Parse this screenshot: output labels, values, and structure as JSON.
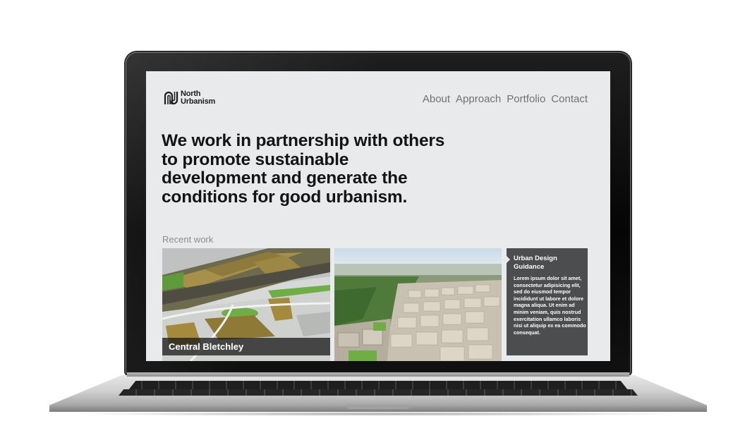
{
  "brand": {
    "line1": "North",
    "line2": "Urbanism"
  },
  "nav": {
    "about": "About",
    "approach": "Approach",
    "portfolio": "Portfolio",
    "contact": "Contact"
  },
  "hero": {
    "headline": "We work in partnership with others to promote sustainable development and generate the conditions for good urbanism."
  },
  "recent_work": {
    "label": "Recent work",
    "cards": [
      {
        "caption": "Central Bletchley",
        "image": "3d-model-aerial"
      },
      {
        "caption": "",
        "image": "city-aerial-render"
      },
      {
        "title": "Urban Design Guidance",
        "body": "Lorem ipsum dolor sit amet, consectetur adipisicing elit, sed do eiusmod tempor incididunt ut labore et dolore magna aliqua. Ut enim ad minim veniam, quis nostrud exercitation ullamco laboris nisi ut aliquip ex ea commodo consequat."
      }
    ]
  },
  "colors": {
    "background": "#e9eaeb",
    "nav_text": "#707274",
    "heading": "#141414",
    "card_panel": "#4b4d4f"
  }
}
